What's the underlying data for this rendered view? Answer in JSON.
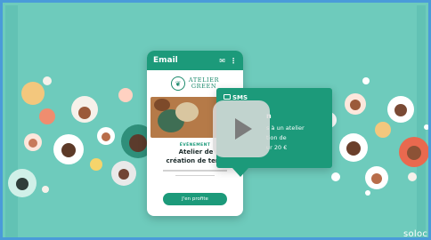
{
  "email_card": {
    "header_title": "Email",
    "brand_line1": "ATELIER",
    "brand_line2": "GREEN",
    "event_tag": "ÉVÉNEMENT",
    "headline_line1": "Atelier de",
    "headline_line2": "création de terra",
    "cta_label": "J'en profite"
  },
  "sms_card": {
    "label": "SMS",
    "name_partial": "n",
    "body_line1": "s à un atelier",
    "body_line2": "tion de",
    "body_line3": "ur 20 €"
  },
  "video": {
    "play_icon": "play-icon"
  },
  "logo_text": "soloc",
  "colors": {
    "background": "#6ecbbc",
    "brand_green": "#1c9a7a",
    "frame_border": "#4a9bd9"
  }
}
